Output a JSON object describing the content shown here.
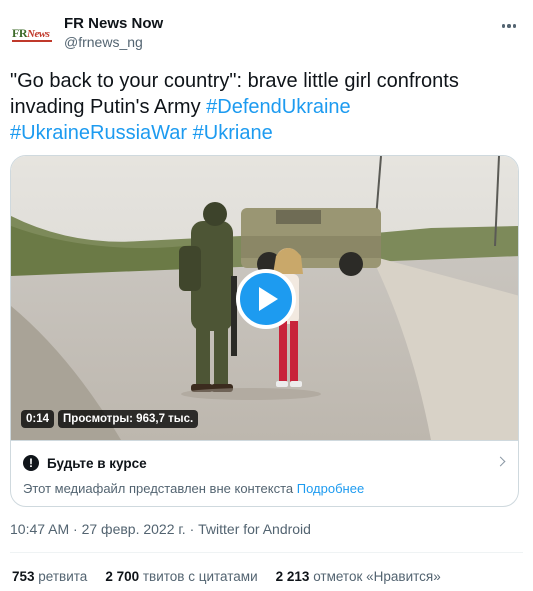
{
  "author": {
    "logo_fr": "FR",
    "logo_news": "News",
    "name": "FR News Now",
    "handle": "@frnews_ng"
  },
  "tweet": {
    "text": "\"Go back to your country\":  brave little girl confronts invading Putin's Army ",
    "hashtags": [
      "#DefendUkraine",
      "#UkraineRussiaWar",
      "#Ukriane"
    ]
  },
  "video": {
    "duration": "0:14",
    "views_label": "Просмотры: 963,7 тыс."
  },
  "media_notice": {
    "title": "Будьте в курсе",
    "body": "Этот медиафайл представлен вне контекста ",
    "link": "Подробнее"
  },
  "meta": {
    "timestamp": "10:47 AM · 27 февр. 2022 г. · Twitter for Android"
  },
  "stats": {
    "retweets_count": "753",
    "retweets_label": "ретвита",
    "quotes_count": "2 700",
    "quotes_label": "твитов с цитатами",
    "likes_count": "2 213",
    "likes_label": "отметок «Нравится»"
  },
  "colors": {
    "accent": "#1d9bf0",
    "text": "#0f1419",
    "secondary": "#536471"
  },
  "icons": [
    "more-icon",
    "play-icon",
    "warning-icon",
    "chevron-right-icon"
  ]
}
